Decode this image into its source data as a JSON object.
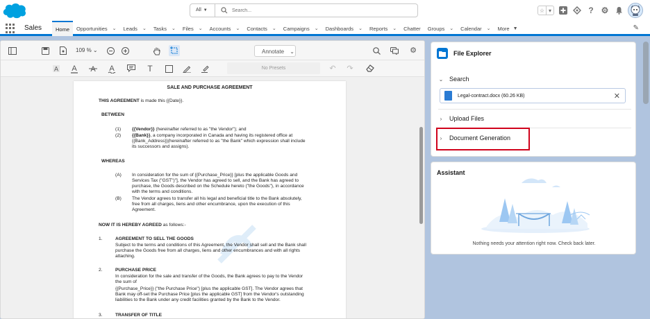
{
  "header": {
    "search_scope": "All",
    "search_placeholder": "Search..."
  },
  "nav": {
    "app_name": "Sales",
    "items": [
      {
        "label": "Home",
        "dropdown": false,
        "active": true
      },
      {
        "label": "Opportunities",
        "dropdown": true
      },
      {
        "label": "Leads",
        "dropdown": true
      },
      {
        "label": "Tasks",
        "dropdown": true
      },
      {
        "label": "Files",
        "dropdown": true
      },
      {
        "label": "Accounts",
        "dropdown": true
      },
      {
        "label": "Contacts",
        "dropdown": true
      },
      {
        "label": "Campaigns",
        "dropdown": true
      },
      {
        "label": "Dashboards",
        "dropdown": true
      },
      {
        "label": "Reports",
        "dropdown": true
      },
      {
        "label": "Chatter",
        "dropdown": false
      },
      {
        "label": "Groups",
        "dropdown": true
      },
      {
        "label": "Calendar",
        "dropdown": true
      },
      {
        "label": "More",
        "dropdown": true
      }
    ]
  },
  "viewer": {
    "zoom": "109 %",
    "mode": "Annotate",
    "presets": "No Presets"
  },
  "document": {
    "title": "SALE AND PURCHASE AGREEMENT",
    "made_bold": "THIS AGREEMENT",
    "made_rest": " is made this {{Date}}.",
    "between": "BETWEEN",
    "party1_num": "(1)",
    "party1_bold": "{{Vendor}}",
    "party1_rest": " (hereinafter referred to as \"the Vendor\"); and",
    "party2_num": "(2)",
    "party2_line1_bold": "{{Bank}}",
    "party2_line1_rest": ", a company incorporated in Canada and having its registered office at",
    "party2_line2": "{{Bank_Address}}(hereinafter referred to as \"the Bank\" which expression shall include",
    "party2_line3": "its successors and assigns).",
    "whereas": "WHEREAS",
    "a_num": "(A)",
    "a_lines": [
      "In consideration for the sum of {{Purchase_Price}} [plus the applicable Goods and",
      "Services Tax (\"GST\")\"], the Vendor has agreed to sell, and the Bank has agreed to",
      "purchase, the Goods described on the Schedule hereto (\"the Goods\"), in accordance",
      "with the terms and conditions."
    ],
    "b_num": "(B)",
    "b_lines": [
      "The Vendor agrees to transfer all his legal and beneficial title to the Bank absolutely,",
      "free from all charges, liens and other encumbrance, upon the execution of this",
      "Agreement."
    ],
    "agreed_bold": "NOW IT IS HEREBY AGREED",
    "agreed_rest": " as follows:-",
    "s1_num": "1.",
    "s1_title": "AGREEMENT TO SELL THE GOODS",
    "s1_lines": [
      "Subject to the terms and conditions of this Agreement, the Vendor shall sell and the Bank shall",
      "purchase the Goods free from all charges, liens and other encumbrances and with all rights",
      "attaching."
    ],
    "s2_num": "2.",
    "s2_title": "PURCHASE PRICE",
    "s2_lines": [
      "In consideration for the sale and transfer of the Goods, the Bank agrees to pay to the Vendor",
      "the sum of",
      "{{Purchase_Price}} (\"the Purchase Price\") [plus the applicable GST]. The Vendor agrees that",
      "Bank may off-set the Purchase Price [plus the applicable GST] from the Vendor's outstanding",
      "liabilities to the Bank under any credit facilities granted by the Bank to the Vendor."
    ],
    "s3_num": "3.",
    "s3_title": "TRANSFER OF TITLE"
  },
  "file_explorer": {
    "title": "File Explorer",
    "search_label": "Search",
    "file_name": "Legal-contract.docx (60.26 KB)",
    "upload_label": "Upload Files",
    "docgen_label": "Document Generation"
  },
  "assistant": {
    "title": "Assistant",
    "message": "Nothing needs your attention right now. Check back later."
  },
  "colors": {
    "brand": "#0176d3",
    "highlight": "#d0021b"
  }
}
